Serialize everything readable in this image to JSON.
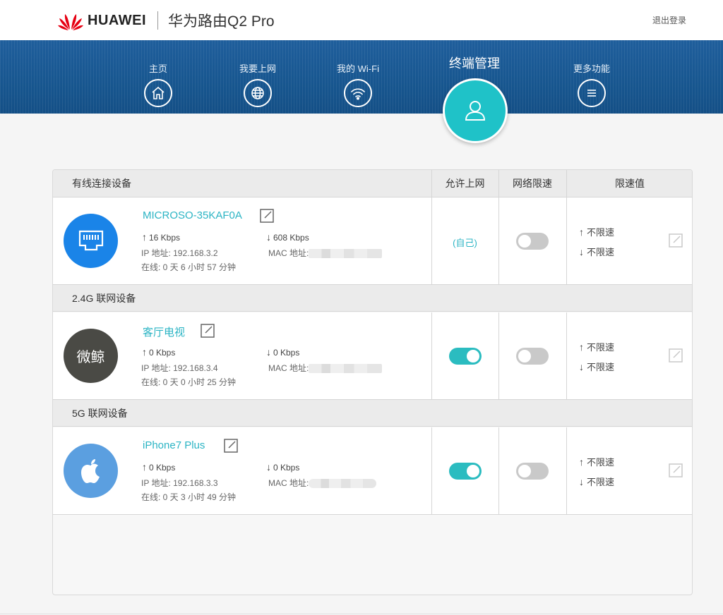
{
  "brand": {
    "name": "HUAWEI",
    "product": "华为路由Q2 Pro",
    "logo_icon": "huawei-flower-logo",
    "logo_color": "#e60012"
  },
  "header": {
    "logout_label": "退出登录"
  },
  "nav": {
    "items": [
      {
        "label": "主页",
        "icon": "home-icon"
      },
      {
        "label": "我要上网",
        "icon": "globe-icon"
      },
      {
        "label": "我的 Wi-Fi",
        "icon": "wifi-icon"
      },
      {
        "label": "更多功能",
        "icon": "menu-icon"
      }
    ],
    "active": {
      "label": "终端管理",
      "icon": "user-icon",
      "color": "#1fc2c8"
    }
  },
  "table": {
    "columns": {
      "allow": "允许上网",
      "speed_limit": "网络限速",
      "limit_value": "限速值"
    },
    "sections": [
      {
        "title": "有线连接设备",
        "device": {
          "name": "MICROSO-35KAF0A",
          "icon": "ethernet-port-icon",
          "avatar_color": "#1a84e8",
          "up": "16 Kbps",
          "down": "608 Kbps",
          "ip": "IP 地址: 192.168.3.2",
          "mac_label": "MAC 地址:",
          "online": "在线:  0 天 6 小时 57 分钟",
          "allow": "(自己)",
          "speed_limit_on": false,
          "limit_up": "不限速",
          "limit_down": "不限速"
        }
      },
      {
        "title": "2.4G 联网设备",
        "device": {
          "name": "客厅电视",
          "avatar_text": "微鲸",
          "avatar_color": "#4a4a45",
          "up": "0 Kbps",
          "down": "0 Kbps",
          "ip": "IP 地址: 192.168.3.4",
          "mac_label": "MAC 地址:",
          "online": "在线:  0 天 0 小时 25 分钟",
          "allow_on": true,
          "speed_limit_on": false,
          "limit_up": "不限速",
          "limit_down": "不限速"
        }
      },
      {
        "title": "5G 联网设备",
        "device": {
          "name": "iPhone7 Plus",
          "icon": "apple-logo-icon",
          "avatar_color": "#5b9fe0",
          "up": "0 Kbps",
          "down": "0 Kbps",
          "ip": "IP 地址: 192.168.3.3",
          "mac_label": "MAC 地址:",
          "online": "在线:  0 天 3 小时 49 分钟",
          "allow_on": true,
          "speed_limit_on": false,
          "limit_up": "不限速",
          "limit_down": "不限速"
        }
      }
    ]
  },
  "glyphs": {
    "up_arrow": "↑",
    "down_arrow": "↓"
  }
}
